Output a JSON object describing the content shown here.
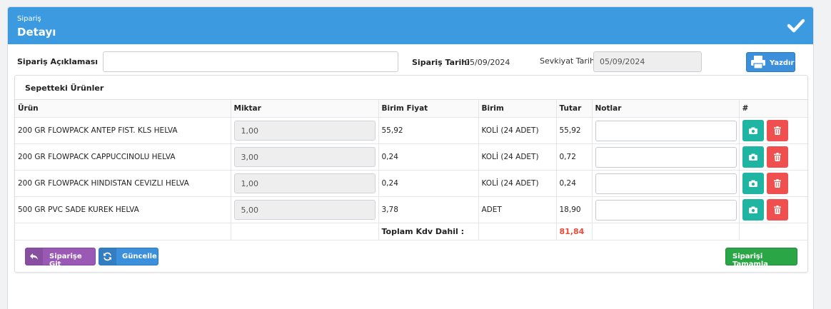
{
  "header": {
    "small_title": "Sipariş",
    "title": "Detayı",
    "icon": "check-icon"
  },
  "form": {
    "description_label": "Sipariş Açıklaması",
    "description_value": "",
    "order_date_label": "Sipariş Tarihi",
    "order_date_value": "05/09/2024",
    "shipping_date_label": "Sevkiyat Tarihi",
    "shipping_date_value": "05/09/2024",
    "print_label": "Yazdır"
  },
  "cart": {
    "title": "Sepetteki Ürünler",
    "columns": [
      "Ürün",
      "Miktar",
      "Birim Fiyat",
      "Birim",
      "Tutar",
      "Notlar",
      "#"
    ],
    "rows": [
      {
        "product": "200 GR FLOWPACK ANTEP FIST. KLS HELVA",
        "quantity": "1,00",
        "unit_price": "55,92",
        "unit": "KOLİ (24 ADET)",
        "amount": "55,92",
        "note": ""
      },
      {
        "product": "200 GR FLOWPACK CAPPUCCINOLU HELVA",
        "quantity": "3,00",
        "unit_price": "0,24",
        "unit": "KOLİ (24 ADET)",
        "amount": "0,72",
        "note": ""
      },
      {
        "product": "200 GR FLOWPACK HINDISTAN CEVIZLI HELVA",
        "quantity": "1,00",
        "unit_price": "0,24",
        "unit": "KOLİ (24 ADET)",
        "amount": "0,24",
        "note": ""
      },
      {
        "product": "500 GR PVC SADE KUREK HELVA",
        "quantity": "5,00",
        "unit_price": "3,78",
        "unit": "ADET",
        "amount": "18,90",
        "note": ""
      }
    ],
    "total_label": "Toplam Kdv Dahil :",
    "total_value": "81,84"
  },
  "footer": {
    "back_label": "Siparişe Git",
    "update_label": "Güncelle",
    "complete_label": "Siparişi Tamamla"
  },
  "colors": {
    "header": "#3b9ae0",
    "camera": "#1fb5a3",
    "delete": "#f04f4f",
    "total": "#e74c3c",
    "back": "#9b59b6",
    "update": "#3b8fdb",
    "complete": "#2aa646"
  }
}
